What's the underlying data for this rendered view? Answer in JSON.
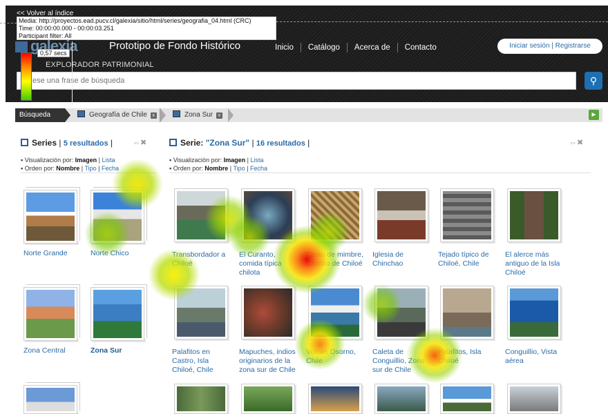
{
  "overlay": {
    "back_link": "<< Volver al índice",
    "media": "Media: http://proyectos.ead.pucv.cl/galexia/sitio/html/series/geografia_04.html (CRC)",
    "time": "Time: 00:00:00.000 - 00:00:03.251",
    "filter": "Participant filter: All",
    "duration": "0,57 secs"
  },
  "header": {
    "logo": "galexia",
    "title": "Prototipo de Fondo Histórico",
    "subtitle": "EXPLORADOR PATRIMONIAL",
    "nav": [
      "Inicio",
      "Catálogo",
      "Acerca de",
      "Contacto"
    ],
    "login": "Iniciar sesión | Registrarse",
    "search_placeholder": "ese una frase de búsqueda",
    "search_icon": "search-icon"
  },
  "breadcrumb": {
    "first": "Búsqueda",
    "items": [
      "Geografía de Chile",
      "Zona Sur"
    ]
  },
  "left_panel": {
    "title": "Series",
    "count": "5 resultados",
    "view_label": "Visualización por:",
    "view_current": "Imagen",
    "view_other": "Lista",
    "order_label": "Orden por:",
    "order_current": "Nombre",
    "order_other1": "Tipo",
    "order_other2": "Fecha",
    "items": [
      "Norte Grande",
      "Norte Chico",
      "Zona Central",
      "Zona Sur"
    ]
  },
  "right_panel": {
    "title": "Serie:",
    "series_name": "\"Zona Sur\"",
    "count": "16 resultados",
    "view_label": "Visualización por:",
    "view_current": "Imagen",
    "view_other": "Lista",
    "order_label": "Orden por:",
    "order_current": "Nombre",
    "order_other1": "Tipo",
    "order_other2": "Fecha",
    "row1": [
      "Transbordador a Chiloé",
      "El Curanto, comida típica chilota",
      "Cesto de mimbre, Castillo de Chiloé",
      "Iglesia de Chinchao",
      "Tejado típico de Chiloé, Chile",
      "El alerce más antiguo de la Isla Chiloé"
    ],
    "row2": [
      "Palafitos en Castro, Isla Chiloé, Chile",
      "Mapuches, indios originarios de la zona sur de Chile",
      "Volcán Osorno, Chile",
      "Caleta de Conguillio, Zona sur de Chile",
      "Palafitos, Isla Chiloé",
      "Conguillio, Vista aérea"
    ]
  },
  "colors": {
    "header_bg": "#1e1e1e",
    "link": "#2a6aa8",
    "search_btn": "#1e6fb3"
  }
}
